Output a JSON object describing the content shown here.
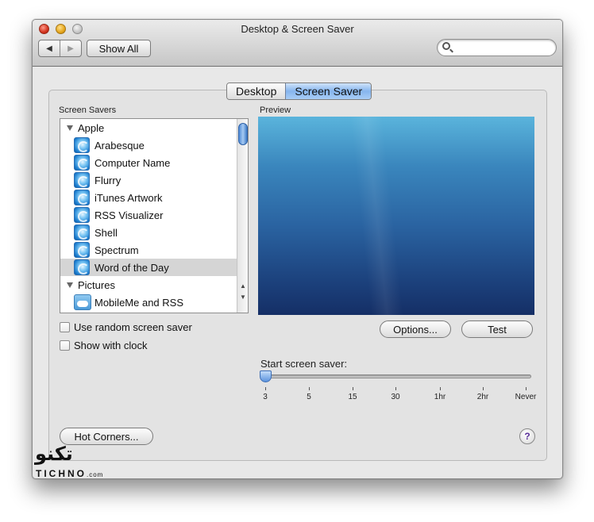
{
  "window": {
    "title": "Desktop & Screen Saver"
  },
  "toolbar": {
    "back_glyph": "◀",
    "forward_glyph": "▶",
    "show_all_label": "Show All",
    "search_placeholder": ""
  },
  "tabs": [
    {
      "label": "Desktop",
      "selected": false
    },
    {
      "label": "Screen Saver",
      "selected": true
    }
  ],
  "screen_savers": {
    "header": "Screen Savers",
    "groups": [
      {
        "label": "Apple",
        "expanded": true
      },
      {
        "label": "Pictures",
        "expanded": true
      }
    ],
    "items": [
      {
        "label": "Arabesque",
        "icon": "screen-saver-icon"
      },
      {
        "label": "Computer Name",
        "icon": "screen-saver-icon"
      },
      {
        "label": "Flurry",
        "icon": "screen-saver-icon"
      },
      {
        "label": "iTunes Artwork",
        "icon": "screen-saver-icon"
      },
      {
        "label": "RSS Visualizer",
        "icon": "screen-saver-icon"
      },
      {
        "label": "Shell",
        "icon": "screen-saver-icon"
      },
      {
        "label": "Spectrum",
        "icon": "screen-saver-icon"
      },
      {
        "label": "Word of the Day",
        "icon": "screen-saver-icon",
        "selected": true
      },
      {
        "label": "MobileMe and RSS",
        "icon": "mobileme-cloud-icon"
      }
    ]
  },
  "preview": {
    "label": "Preview"
  },
  "buttons": {
    "options": "Options...",
    "test": "Test",
    "hot_corners": "Hot Corners..."
  },
  "options": {
    "random": {
      "label": "Use random screen saver",
      "checked": false
    },
    "clock": {
      "label": "Show with clock",
      "checked": false
    }
  },
  "start_slider": {
    "label": "Start screen saver:",
    "ticks": [
      "3",
      "5",
      "15",
      "30",
      "1hr",
      "2hr",
      "Never"
    ],
    "selected": "3"
  },
  "help": {
    "glyph": "?"
  },
  "watermark": {
    "arabic": "تكنو",
    "latin": "TICHNO",
    "suffix": ".com"
  }
}
